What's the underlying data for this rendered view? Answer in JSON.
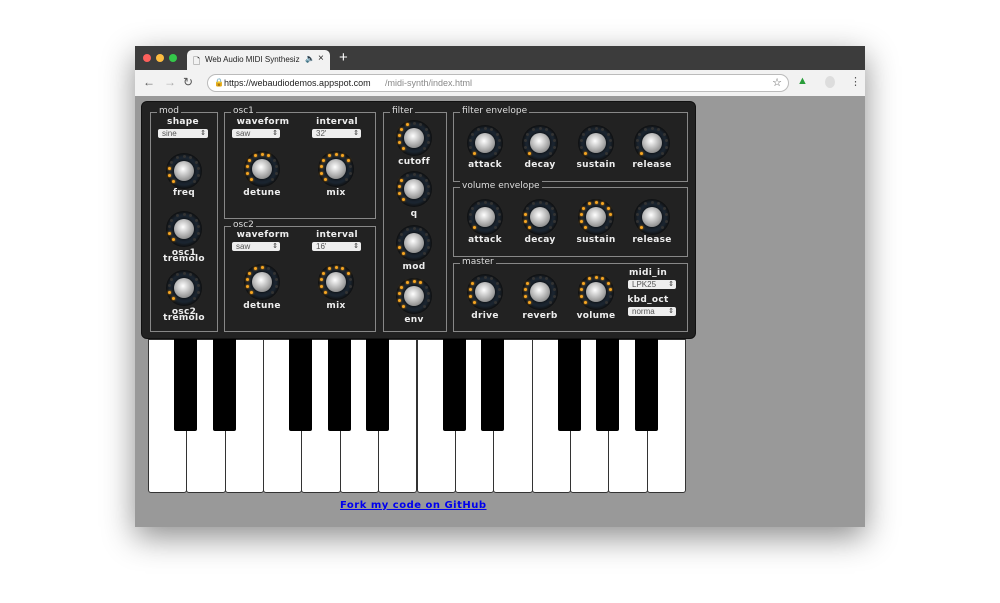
{
  "browser": {
    "tab_title": "Web Audio MIDI Synthesiz",
    "url_host": "https://webaudiodemos.appspot.com",
    "url_path": "/midi-synth/index.html",
    "new_tab": "+",
    "close": "×"
  },
  "colors": {
    "led_on": "#f6a623",
    "panel": "#222222",
    "link": "#0000ee"
  },
  "mod": {
    "legend": "mod",
    "shape_label": "shape",
    "shape_value": "sine",
    "freq": {
      "label": "freq",
      "value": 0.2
    },
    "osc1_tremolo": {
      "label": "osc1 tremolo",
      "value": 0.15
    },
    "osc2_tremolo": {
      "label": "osc2 tremolo",
      "value": 0.15
    }
  },
  "osc1": {
    "legend": "OSC1",
    "waveform_label": "waveform",
    "waveform_value": "saw",
    "interval_label": "interval",
    "interval_value": "32'",
    "detune": {
      "label": "detune",
      "value": 0.6
    },
    "mix": {
      "label": "mix",
      "value": 0.7
    }
  },
  "osc2": {
    "legend": "OSC2",
    "waveform_label": "waveform",
    "waveform_value": "saw",
    "interval_label": "interval",
    "interval_value": "16'",
    "detune": {
      "label": "detune",
      "value": 0.5
    },
    "mix": {
      "label": "mix",
      "value": 0.7
    }
  },
  "filter": {
    "legend": "filter",
    "cutoff": {
      "label": "cutoff",
      "value": 0.4
    },
    "q": {
      "label": "q",
      "value": 0.35
    },
    "mod": {
      "label": "mod",
      "value": 0.12
    },
    "env": {
      "label": "env",
      "value": 0.6
    }
  },
  "filter_env": {
    "legend": "filter envelope",
    "attack": {
      "label": "attack",
      "value": 0.05
    },
    "decay": {
      "label": "decay",
      "value": 0.05
    },
    "sustain": {
      "label": "sustain",
      "value": 0.05
    },
    "release": {
      "label": "release",
      "value": 0.05
    }
  },
  "volume_env": {
    "legend": "volume envelope",
    "attack": {
      "label": "attack",
      "value": 0.05
    },
    "decay": {
      "label": "decay",
      "value": 0.2
    },
    "sustain": {
      "label": "sustain",
      "value": 0.8
    },
    "release": {
      "label": "release",
      "value": 0.05
    }
  },
  "master": {
    "legend": "master",
    "drive": {
      "label": "drive",
      "value": 0.35
    },
    "reverb": {
      "label": "reverb",
      "value": 0.3
    },
    "volume": {
      "label": "volume",
      "value": 0.85
    },
    "midi_in_label": "midi_in",
    "midi_in_value": "LPK25",
    "kbd_oct_label": "kbd_oct",
    "kbd_oct_value": "norma"
  },
  "github_link": "Fork my code on GitHub"
}
